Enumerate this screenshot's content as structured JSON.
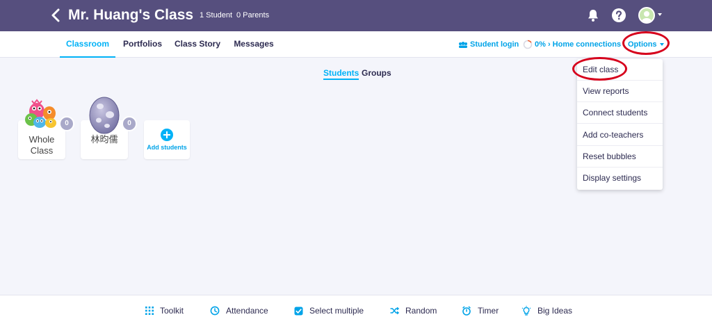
{
  "header": {
    "title": "Mr. Huang's Class",
    "students_count": "1 Student",
    "parents_count": "0 Parents"
  },
  "nav": {
    "tabs": [
      {
        "label": "Classroom",
        "active": true
      },
      {
        "label": "Portfolios",
        "active": false
      },
      {
        "label": "Class Story",
        "active": false
      },
      {
        "label": "Messages",
        "active": false
      }
    ],
    "student_login": "Student login",
    "home_connections": "0% › Home connections",
    "options": "Options"
  },
  "view_toggle": {
    "students": "Students",
    "groups": "Groups",
    "active": "students"
  },
  "cards": {
    "whole_class": {
      "label_line1": "Whole",
      "label_line2": "Class",
      "points": "0"
    },
    "student": {
      "name": "林昀儒",
      "points": "0"
    },
    "add": {
      "label": "Add students"
    }
  },
  "options_menu": {
    "items": [
      "Edit class",
      "View reports",
      "Connect students",
      "Add co-teachers",
      "Reset bubbles",
      "Display settings"
    ]
  },
  "toolbar": {
    "items": [
      {
        "label": "Toolkit",
        "icon": "grid-icon"
      },
      {
        "label": "Attendance",
        "icon": "clock-icon"
      },
      {
        "label": "Select multiple",
        "icon": "checkbox-icon"
      },
      {
        "label": "Random",
        "icon": "shuffle-icon"
      },
      {
        "label": "Timer",
        "icon": "timer-icon"
      },
      {
        "label": "Big Ideas",
        "icon": "lightbulb-icon"
      }
    ]
  },
  "colors": {
    "header_bg": "#564f7e",
    "accent": "#00b2f7",
    "annotation": "#d6001c",
    "page_bg": "#f4f5fb"
  }
}
